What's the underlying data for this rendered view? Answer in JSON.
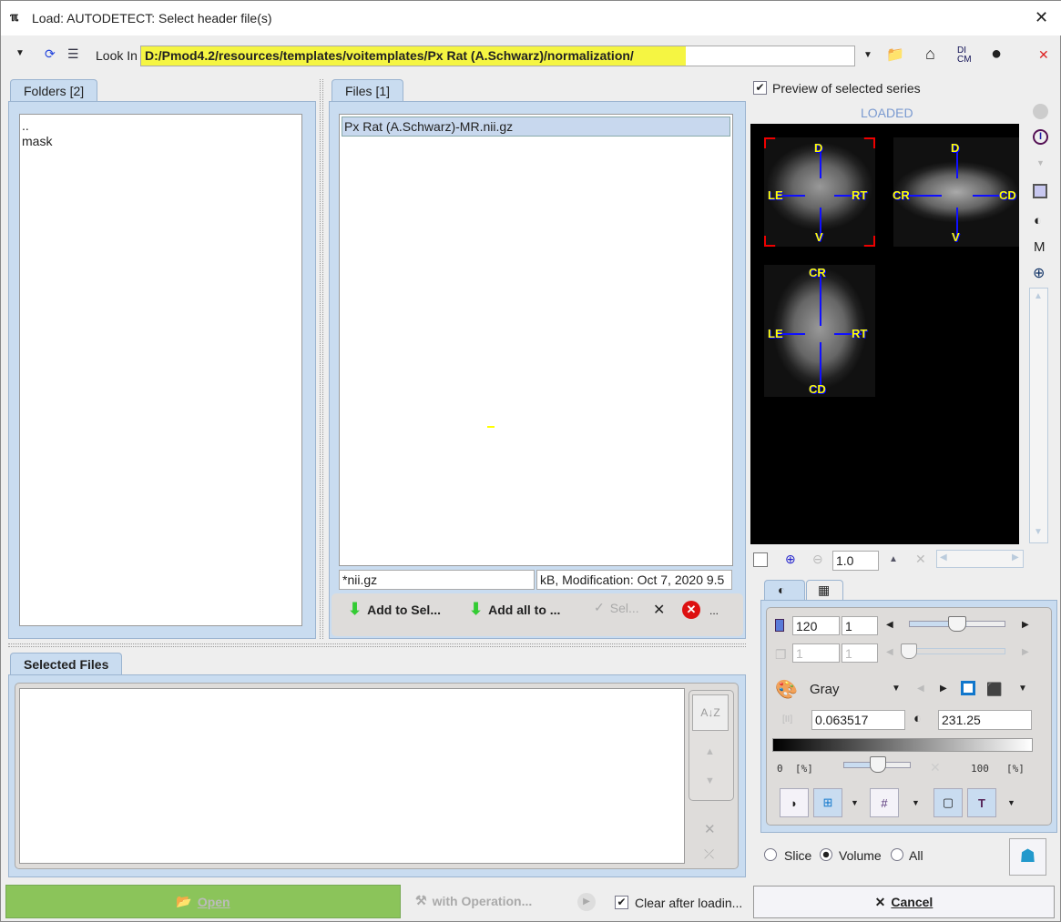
{
  "window": {
    "title": "Load: AUTODETECT: Select header file(s)",
    "close": "✕"
  },
  "toolbar": {
    "look_in_label": "Look In",
    "path": "D:/Pmod4.2/resources/templates/voitemplates/Px Rat (A.Schwarz)/normalization/",
    "highlight_color": "#f5f542"
  },
  "folders": {
    "tab_label": "Folders [2]",
    "items": [
      "..",
      "mask"
    ]
  },
  "files": {
    "tab_label": "Files [1]",
    "items": [
      "Px Rat (A.Schwarz)-MR.nii.gz"
    ],
    "filter": "*nii.gz",
    "info": "9.5 kB,  Modification: Oct 7, 2020",
    "add_to_sel": "Add to Sel...",
    "add_all": "Add all to ...",
    "sel": "Sel...",
    "more": "..."
  },
  "selected": {
    "tab_label": "Selected Files"
  },
  "preview": {
    "checkbox_label": "Preview of selected series",
    "checked": true,
    "status": "LOADED",
    "labels": {
      "d": "D",
      "v": "V",
      "le": "LE",
      "rt": "RT",
      "cr": "CR",
      "cd": "CD"
    },
    "zoom": "1.0"
  },
  "display": {
    "slice_value": "120",
    "slice_step": "1",
    "frame_value": "1",
    "frame_step": "1",
    "slice_slider_percent": 60,
    "colormap": "Gray",
    "min": "0.063517",
    "max": "231.25",
    "pct_min": "0",
    "pct_max": "100",
    "pct_unit": "[%]"
  },
  "mode": {
    "options": [
      "Slice",
      "Volume",
      "All"
    ],
    "selected": "Volume"
  },
  "bottom": {
    "open": "Open",
    "with_operation": "with Operation...",
    "clear_after": "Clear after loadin...",
    "clear_checked": true,
    "cancel": "Cancel",
    "open_color": "#8bc45a"
  }
}
